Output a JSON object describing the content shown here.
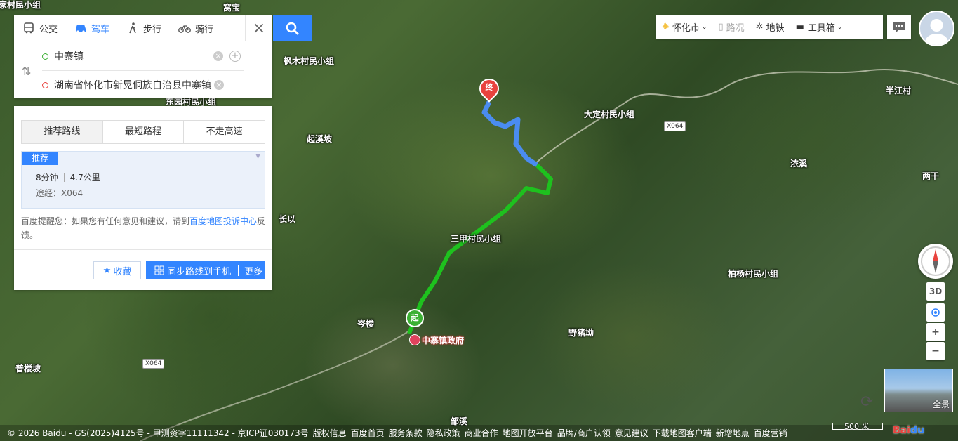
{
  "map": {
    "places": [
      {
        "name": "家村民小组"
      },
      {
        "name": "窝宝"
      },
      {
        "name": "枫木村民小组"
      },
      {
        "name": "东园村民小组"
      },
      {
        "name": "起溪坡"
      },
      {
        "name": "大定村民小组"
      },
      {
        "name": "半江村"
      },
      {
        "name": "浓溪"
      },
      {
        "name": "两干"
      },
      {
        "name": "长以"
      },
      {
        "name": "三甲村民小组"
      },
      {
        "name": "柏杨村民小组"
      },
      {
        "name": "岑楼"
      },
      {
        "name": "野猪坳"
      },
      {
        "name": "普楼坡"
      },
      {
        "name": "邹溪"
      },
      {
        "name": "中寨镇政府"
      }
    ],
    "road_tags": [
      "X064",
      "X064"
    ],
    "start_marker": "起",
    "end_marker": "终",
    "pano_label": "全景",
    "scale_label": "500 米"
  },
  "search": {
    "modes": [
      {
        "label": "公交",
        "icon": "bus-icon"
      },
      {
        "label": "驾车",
        "icon": "car-icon"
      },
      {
        "label": "步行",
        "icon": "walk-icon"
      },
      {
        "label": "骑行",
        "icon": "bike-icon"
      }
    ],
    "active_mode": "驾车",
    "origin": "中寨镇",
    "destination": "湖南省怀化市新晃侗族自治县中寨镇"
  },
  "route": {
    "tabs": [
      "推荐路线",
      "最短路程",
      "不走高速"
    ],
    "tag": "推荐",
    "time": "8分钟",
    "distance": "4.7公里",
    "via": "途经：X064",
    "note_prefix": "百度提醒您：如果您有任何意见和建议，请到",
    "note_link": "百度地图投诉中心",
    "note_suffix": "反馈。",
    "fav": "收藏",
    "sync": "同步路线到手机",
    "more": "更多"
  },
  "toolbar": {
    "city": "怀化市",
    "traffic": "路况",
    "subway": "地铁",
    "toolbox": "工具箱"
  },
  "controls": {
    "three_d": "3D",
    "zoom_in": "+",
    "zoom_out": "−"
  },
  "footer": {
    "copyright": "© 2026 Baidu - GS(2025)4125号 - 甲测资字11111342 - 京ICP证030173号",
    "links": [
      "版权信息",
      "百度首页",
      "服务条款",
      "隐私政策",
      "商业合作",
      "地图开放平台",
      "品牌/商户认领",
      "意见建议",
      "下载地图客户端",
      "新增地点",
      "百度营销"
    ]
  },
  "colors": {
    "accent": "#3385ff",
    "route_green": "#1ec11e",
    "route_blue": "#4a8cf0"
  }
}
